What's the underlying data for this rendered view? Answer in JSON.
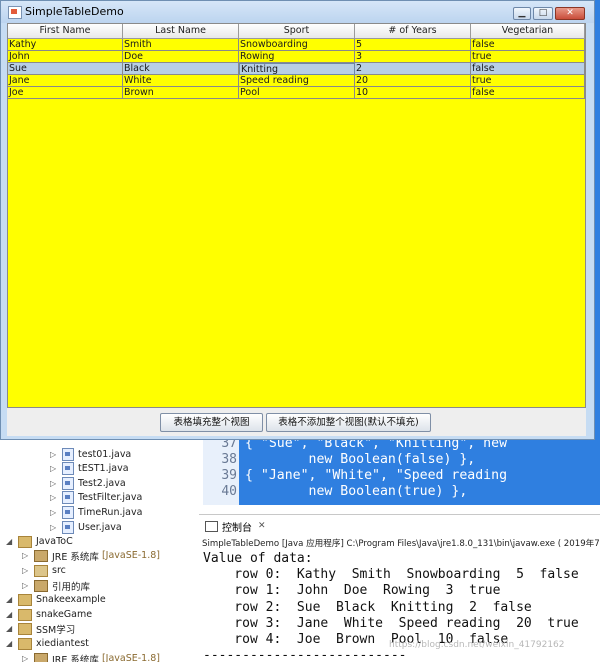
{
  "window": {
    "title": "SimpleTableDemo"
  },
  "table": {
    "columns": [
      "First Name",
      "Last Name",
      "Sport",
      "# of Years",
      "Vegetarian"
    ],
    "rows": [
      [
        "Kathy",
        "Smith",
        "Snowboarding",
        "5",
        "false"
      ],
      [
        "John",
        "Doe",
        "Rowing",
        "3",
        "true"
      ],
      [
        "Sue",
        "Black",
        "Knitting",
        "2",
        "false"
      ],
      [
        "Jane",
        "White",
        "Speed reading",
        "20",
        "true"
      ],
      [
        "Joe",
        "Brown",
        "Pool",
        "10",
        "false"
      ]
    ],
    "selected_row": 2,
    "background_color": "#ffff00",
    "selection_color": "#b8cfe5"
  },
  "buttons": {
    "fill_viewport": "表格填充整个视图",
    "no_fill_viewport": "表格不添加整个视图(默认不填充)"
  },
  "editor": {
    "lines": [
      {
        "num": "37",
        "text": "{ \"Sue\", \"Black\", \"Knitting\", new"
      },
      {
        "num": "38",
        "text": "        new Boolean(false) },"
      },
      {
        "num": "39",
        "text": "{ \"Jane\", \"White\", \"Speed reading"
      },
      {
        "num": "40",
        "text": "        new Boolean(true) },"
      }
    ],
    "edge_marks": [
      "\"",
      "n",
      "I"
    ]
  },
  "explorer": {
    "items": [
      {
        "label": "test01.java",
        "kind": "java"
      },
      {
        "label": "tEST1.java",
        "kind": "java"
      },
      {
        "label": "Test2.java",
        "kind": "java"
      },
      {
        "label": "TestFilter.java",
        "kind": "java"
      },
      {
        "label": "TimeRun.java",
        "kind": "java"
      },
      {
        "label": "User.java",
        "kind": "java"
      },
      {
        "label": "JavaToC",
        "kind": "project"
      },
      {
        "label": "JRE 系统库",
        "suffix": "[JavaSE-1.8]",
        "kind": "lib"
      },
      {
        "label": "src",
        "kind": "src"
      },
      {
        "label": "引用的库",
        "kind": "lib"
      },
      {
        "label": "Snakeexample",
        "kind": "project"
      },
      {
        "label": "snakeGame",
        "kind": "project"
      },
      {
        "label": "SSM学习",
        "kind": "project"
      },
      {
        "label": "xiediantest",
        "kind": "project"
      },
      {
        "label": "JRE 系统库",
        "suffix": "[JavaSE-1.8]",
        "kind": "lib"
      }
    ]
  },
  "console": {
    "tab_label": "控制台",
    "info": "SimpleTableDemo [Java 应用程序] C:\\Program Files\\Java\\jre1.8.0_131\\bin\\javaw.exe ( 2019年7",
    "output": [
      "Value of data:",
      "    row 0:  Kathy  Smith  Snowboarding  5  false",
      "    row 1:  John  Doe  Rowing  3  true",
      "    row 2:  Sue  Black  Knitting  2  false",
      "    row 3:  Jane  White  Speed reading  20  true",
      "    row 4:  Joe  Brown  Pool  10  false",
      "--------------------------"
    ]
  },
  "watermark": "https://blog.csdn.net/weixin_41792162"
}
